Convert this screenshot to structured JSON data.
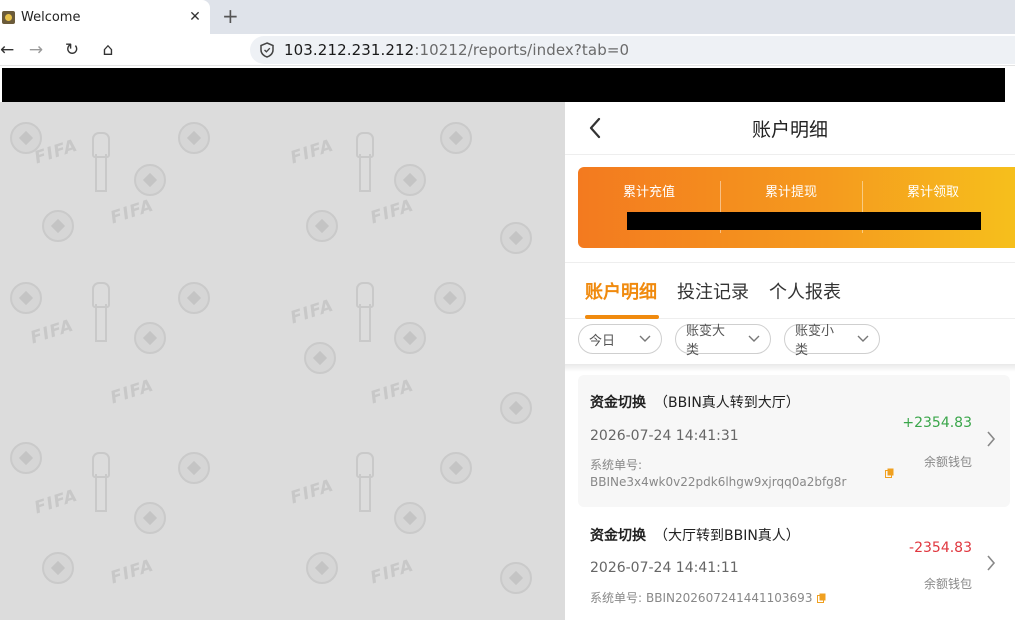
{
  "browser": {
    "tab_title": "Welcome",
    "tab_close": "✕",
    "new_tab": "+",
    "url_host": "103.212.231.212",
    "url_rest": ":10212/reports/index?tab=0",
    "back_glyph": "←",
    "forward_glyph": "→",
    "reload_glyph": "↻",
    "home_glyph": "⌂"
  },
  "panel": {
    "title": "账户明细",
    "summary": [
      {
        "label": "累计充值"
      },
      {
        "label": "累计提现"
      },
      {
        "label": "累计领取"
      }
    ],
    "tabs": [
      "账户明细",
      "投注记录",
      "个人报表"
    ],
    "filters": [
      "今日",
      "账变大类",
      "账变小类"
    ],
    "records": [
      {
        "type": "资金切换",
        "detail": "（BBIN真人转到大厅）",
        "time": "2026-07-24 14:41:31",
        "amount": "+2354.83",
        "wallet": "余额钱包",
        "sn_label": "系统单号:",
        "sn": "BBINe3x4wk0v22pdk6lhgw9xjrqq0a2bfg8r"
      },
      {
        "type": "资金切换",
        "detail": "（大厅转到BBIN真人）",
        "time": "2026-07-24 14:41:11",
        "amount": "-2354.83",
        "wallet": "余额钱包",
        "sn_label": "系统单号:",
        "sn": "BBIN202607241441103693"
      }
    ]
  },
  "colors": {
    "accent": "#f08a0e",
    "positive": "#3aa64a",
    "negative": "#e0373f"
  }
}
